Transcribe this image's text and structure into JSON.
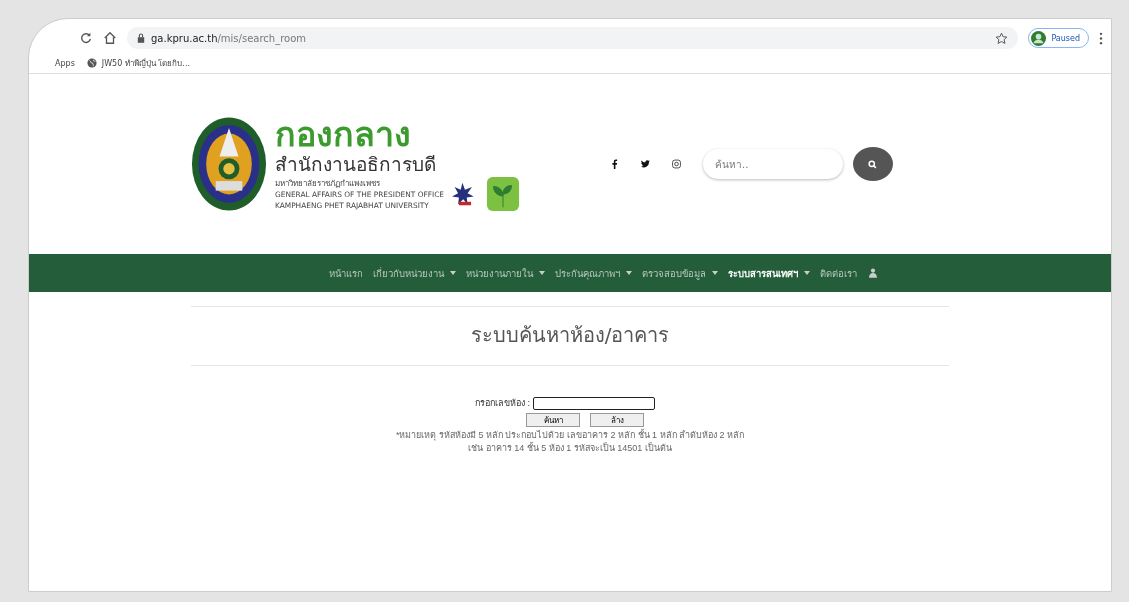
{
  "browser": {
    "url_host": "ga.kpru.ac.th",
    "url_path": "/mis/search_room",
    "bookmarks": [
      {
        "label": "Apps"
      },
      {
        "label": "JW50 ทำพีญี่ปุ่น โดยกิบ..."
      }
    ],
    "profile": "Paused"
  },
  "header": {
    "title": "กองกลาง",
    "subtitle": "สำนักงานอธิการบดี",
    "lines": [
      "มหาวิทยาลัยราชภัฏกำแพงเพชร",
      "GENERAL AFFAIRS OF THE PRESIDENT OFFICE",
      "KAMPHAENG PHET RAJABHAT UNIVERSITY"
    ],
    "search": {
      "placeholder": "ค้นหา.."
    }
  },
  "nav": [
    {
      "label": "หน้าแรก",
      "dropdown": false,
      "selected": false
    },
    {
      "label": "เกี่ยวกับหน่วยงาน",
      "dropdown": true,
      "selected": false
    },
    {
      "label": "หน่วยงานภายใน",
      "dropdown": true,
      "selected": false
    },
    {
      "label": "ประกันคุณภาพฯ",
      "dropdown": true,
      "selected": false
    },
    {
      "label": "ตรวจสอบข้อมูล",
      "dropdown": true,
      "selected": false
    },
    {
      "label": "ระบบสารสนเทศฯ",
      "dropdown": true,
      "selected": true
    },
    {
      "label": "ติดต่อเรา",
      "dropdown": false,
      "selected": false
    }
  ],
  "page": {
    "title": "ระบบค้นหาห้อง/อาคาร",
    "field_label": "กรอกเลขห้อง :",
    "buttons": [
      "ค้นหา",
      "ล้าง"
    ],
    "notes": [
      "*หมายเหตุ รหัสห้องมี 5 หลัก ประกอบไปด้วย เลขอาคาร 2 หลัก ชั้น 1 หลัก ลำดับห้อง 2 หลัก",
      "เช่น อาคาร 14 ชั้น 5 ห้อง 1 รหัสจะเป็น 14501 เป็นต้น"
    ]
  }
}
